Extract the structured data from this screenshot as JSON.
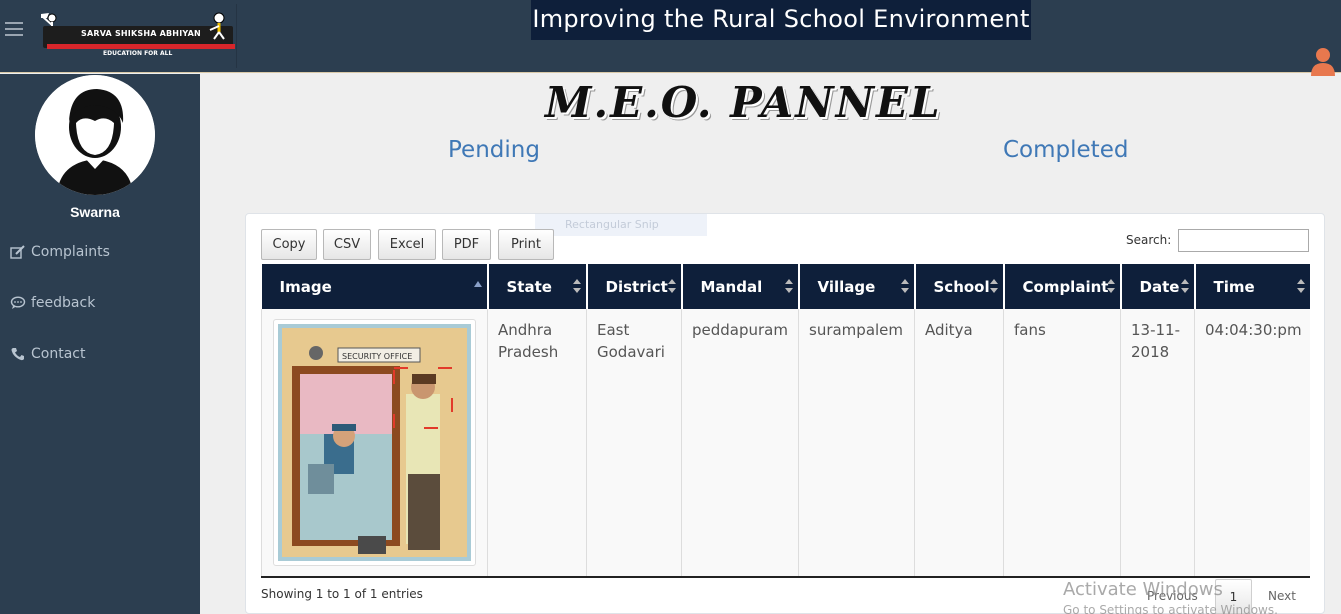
{
  "header": {
    "logo_text": "SARVA SHIKSHA ABHIYAN",
    "logo_subtext": "EDUCATION FOR ALL",
    "banner": "Improving  the  Rural  School Environment"
  },
  "sidebar": {
    "username": "Swarna",
    "items": [
      {
        "label": "Complaints",
        "icon": "edit-icon"
      },
      {
        "label": "feedback",
        "icon": "comment-icon"
      },
      {
        "label": "Contact",
        "icon": "phone-icon"
      }
    ]
  },
  "main": {
    "title": "M.E.O. PANNEL",
    "tabs": [
      {
        "label": "Pending"
      },
      {
        "label": "Completed"
      }
    ]
  },
  "snip_overlay": "Rectangular Snip",
  "table": {
    "buttons": [
      "Copy",
      "CSV",
      "Excel",
      "PDF",
      "Print"
    ],
    "search_label": "Search:",
    "search_value": "",
    "columns": [
      "Image",
      "State",
      "District",
      "Mandal",
      "Village",
      "School",
      "Complaint",
      "Date",
      "Time"
    ],
    "rows": [
      {
        "state": "Andhra Pradesh",
        "district": "East Godavari",
        "mandal": "peddapuram",
        "village": "surampalem",
        "school": "Aditya",
        "complaint": "fans",
        "date": "13-11-2018",
        "time": "04:04:30:pm",
        "image_sign_text": "SECURITY OFFICE"
      }
    ],
    "info": "Showing 1 to 1 of 1 entries",
    "pagination": {
      "previous": "Previous",
      "current": "1",
      "next": "Next"
    }
  },
  "watermark": {
    "line1": "Activate Windows",
    "line2": "Go to Settings to activate Windows."
  },
  "colors": {
    "navy": "#2c3e50",
    "banner_bg": "#0e1f3a",
    "link_blue": "#3f78b6",
    "user_icon": "#e8784e"
  }
}
